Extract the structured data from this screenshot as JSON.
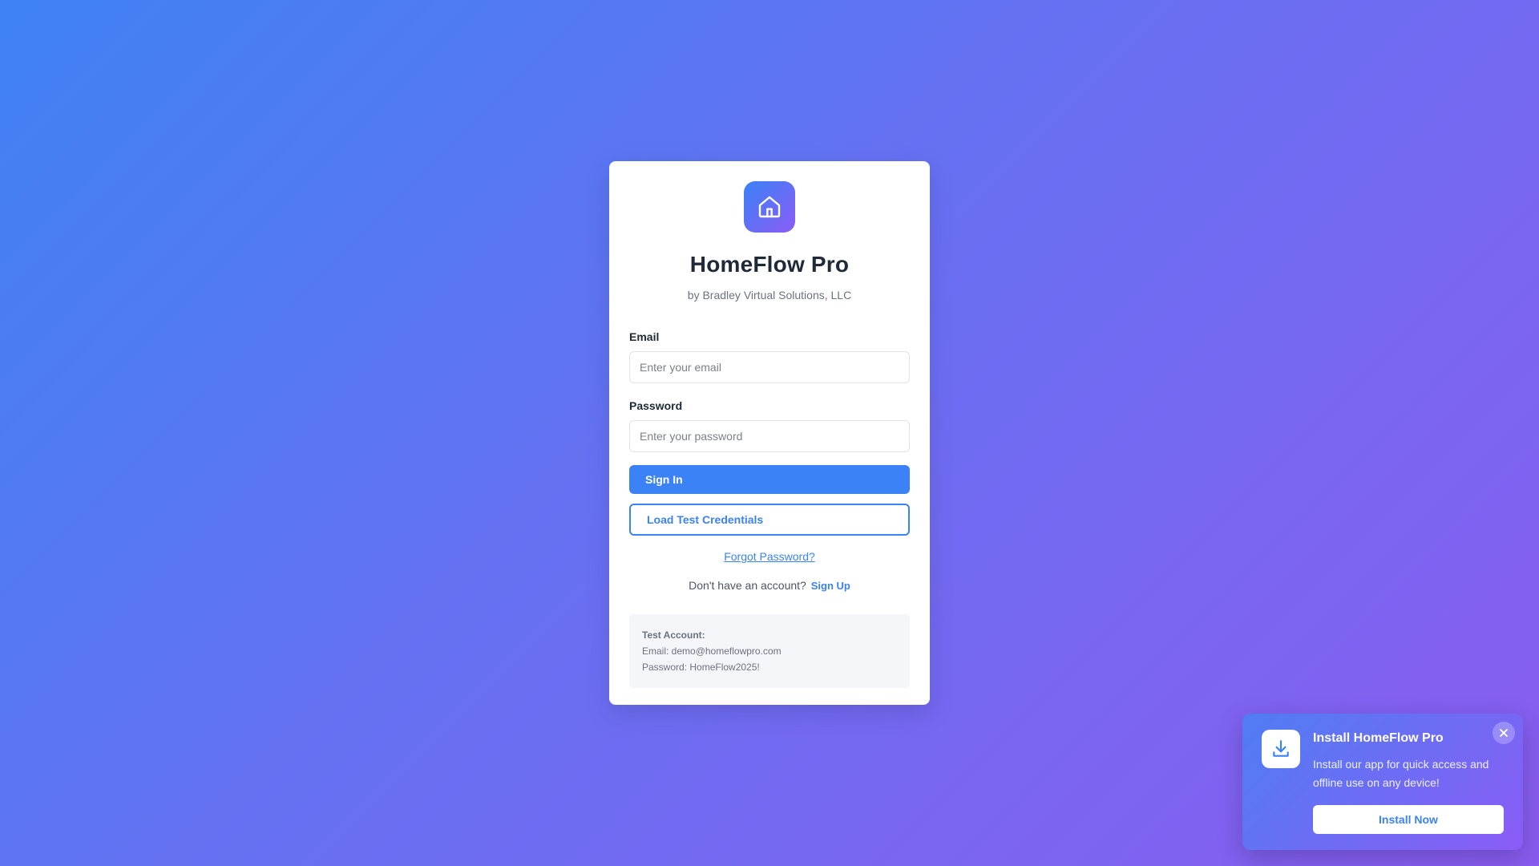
{
  "app": {
    "title": "HomeFlow Pro",
    "subtitle": "by Bradley Virtual Solutions, LLC",
    "logo_icon": "home-icon"
  },
  "login_form": {
    "email_label": "Email",
    "email_placeholder": "Enter your email",
    "email_value": "",
    "password_label": "Password",
    "password_placeholder": "Enter your password",
    "password_value": "",
    "sign_in_label": "Sign In",
    "load_test_label": "Load Test Credentials",
    "forgot_label": "Forgot Password?",
    "signup_prompt": "Don't have an account?",
    "signup_label": "Sign Up"
  },
  "test_account": {
    "title": "Test Account:",
    "email_line": "Email: demo@homeflowpro.com",
    "password_line": "Password: HomeFlow2025!"
  },
  "install_prompt": {
    "title": "Install HomeFlow Pro",
    "description": "Install our app for quick access and offline use on any device!",
    "button_label": "Install Now",
    "icon": "download-icon",
    "close_icon": "close-icon"
  },
  "colors": {
    "accent": "#3b82f6",
    "gradient_start": "#3f82f5",
    "gradient_end": "#8a5cf0"
  }
}
